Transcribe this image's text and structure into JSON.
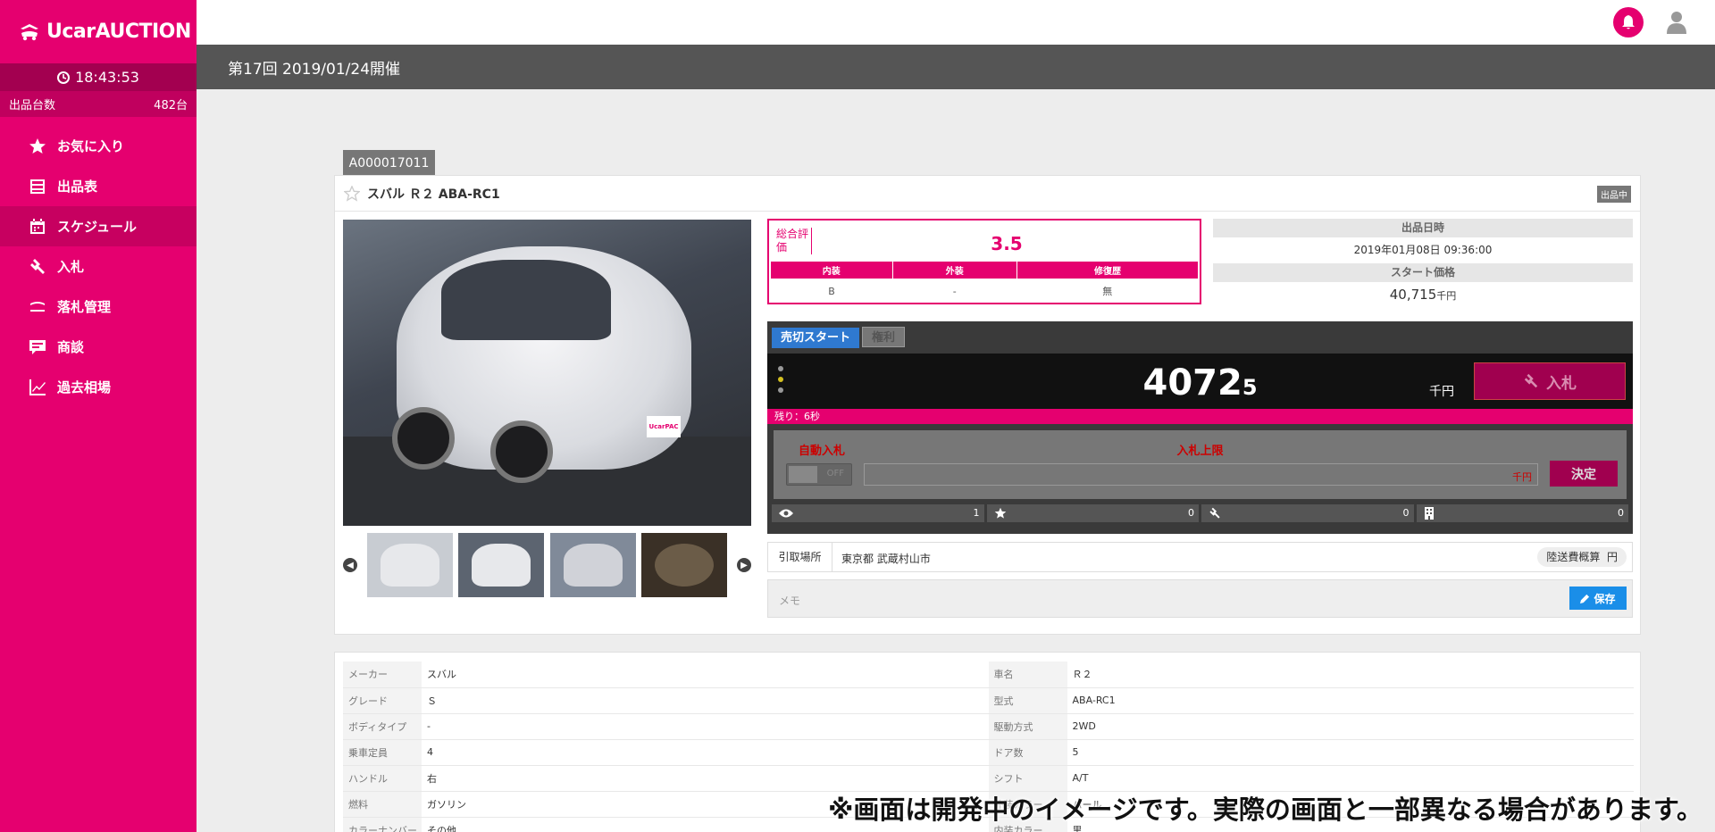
{
  "app": {
    "brand": "UcarAUCTION",
    "clock": "18:43:53",
    "count_label": "出品台数",
    "count_value": "482台"
  },
  "nav": [
    {
      "label": "お気に入り",
      "icon": "star-icon"
    },
    {
      "label": "出品表",
      "icon": "table-icon"
    },
    {
      "label": "スケジュール",
      "icon": "calendar-icon",
      "active": true
    },
    {
      "label": "入札",
      "icon": "gavel-icon"
    },
    {
      "label": "落札管理",
      "icon": "hammer-icon"
    },
    {
      "label": "商談",
      "icon": "chat-icon"
    },
    {
      "label": "過去相場",
      "icon": "chart-icon"
    }
  ],
  "header": {
    "session": "第17回 2019/01/24開催"
  },
  "lot": {
    "id": "A000017011",
    "title": "スバル Ｒ２ ABA-RC1",
    "status": "出品中"
  },
  "rating": {
    "label": "総合評価",
    "score": "3.5",
    "headers": [
      "内装",
      "外装",
      "修復歴"
    ],
    "values": [
      "B",
      "-",
      "無"
    ]
  },
  "info": {
    "listed_label": "出品日時",
    "listed_value": "2019年01月08日 09:36:00",
    "start_label": "スタート価格",
    "start_value": "40,715",
    "start_unit": "千円"
  },
  "bid": {
    "tab_active": "売切スタート",
    "tab_inactive": "権利",
    "price_main": "4072",
    "price_small": "5",
    "price_unit": "千円",
    "bid_button": "入札",
    "remaining": "残り：6秒",
    "auto_label": "自動入札",
    "auto_toggle": "OFF",
    "limit_label": "入札上限",
    "limit_unit": "千円",
    "confirm": "決定",
    "stats": [
      {
        "icon": "eye-icon",
        "value": "1"
      },
      {
        "icon": "star-icon",
        "value": "0"
      },
      {
        "icon": "gavel-icon",
        "value": "0"
      },
      {
        "icon": "building-icon",
        "value": "0"
      }
    ]
  },
  "pickup": {
    "label": "引取場所",
    "value": "東京都 武蔵村山市",
    "ship": "陸送費概算",
    "ship_unit": "円"
  },
  "memo": {
    "placeholder": "メモ",
    "save": "保存"
  },
  "details": [
    [
      "メーカー",
      "スバル",
      "車名",
      "Ｒ２"
    ],
    [
      "グレード",
      "Ｓ",
      "型式",
      "ABA-RC1"
    ],
    [
      "ボディタイプ",
      "-",
      "駆動方式",
      "2WD"
    ],
    [
      "乗車定員",
      "4",
      "ドア数",
      "5"
    ],
    [
      "ハンドル",
      "右",
      "シフト",
      "A/T"
    ],
    [
      "燃料",
      "ガソリン",
      "外装カラー",
      "パール"
    ],
    [
      "カラーナンバー",
      "その他",
      "内装カラー",
      "黒"
    ]
  ],
  "notice": "※画面は開発中のイメージです。実際の画面と一部異なる場合があります。",
  "colors": {
    "brand": "#e5006f",
    "accent_blue": "#2f79d0"
  }
}
